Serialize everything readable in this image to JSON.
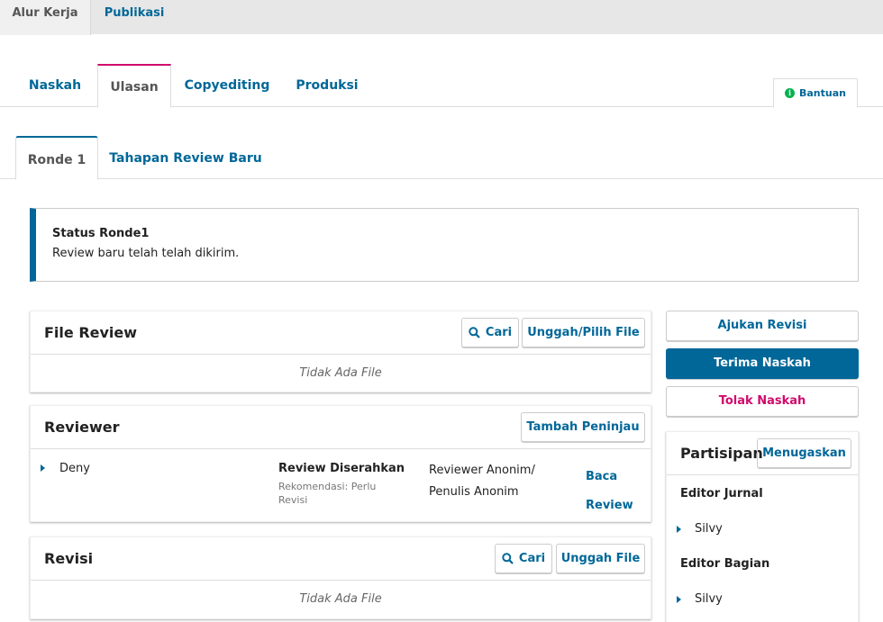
{
  "top_tabs": {
    "workflow": "Alur Kerja",
    "publication": "Publikasi"
  },
  "stage_tabs": [
    "Naskah",
    "Ulasan",
    "Copyediting",
    "Produksi"
  ],
  "help_label": "Bantuan",
  "round_tabs": {
    "round1": "Ronde 1",
    "new_round": "Tahapan Review Baru"
  },
  "status": {
    "title": "Status Ronde1",
    "text": "Review baru telah telah dikirim."
  },
  "review_files": {
    "title": "File Review",
    "search": "Cari",
    "upload": "Unggah/Pilih File",
    "empty": "Tidak Ada File"
  },
  "reviewers": {
    "title": "Reviewer",
    "add": "Tambah Peninjau",
    "rows": [
      {
        "name": "Deny",
        "status": "Review Diserahkan",
        "recommendation": "Rekomendasi: Perlu Revisi",
        "type": "Reviewer Anonim/ Penulis Anonim",
        "action": "Baca Review"
      }
    ]
  },
  "revisions": {
    "title": "Revisi",
    "search": "Cari",
    "upload": "Unggah File",
    "empty": "Tidak Ada File"
  },
  "decisions": {
    "request_revisions": "Ajukan Revisi",
    "accept": "Terima Naskah",
    "decline": "Tolak Naskah"
  },
  "participants": {
    "title": "Partisipan",
    "assign": "Menugaskan",
    "groups": [
      {
        "role": "Editor Jurnal",
        "people": [
          "Silvy"
        ]
      },
      {
        "role": "Editor Bagian",
        "people": [
          "Silvy"
        ]
      }
    ]
  },
  "colors": {
    "primary": "#006798",
    "danger": "#d00a6c",
    "help_icon": "#00b24e"
  }
}
